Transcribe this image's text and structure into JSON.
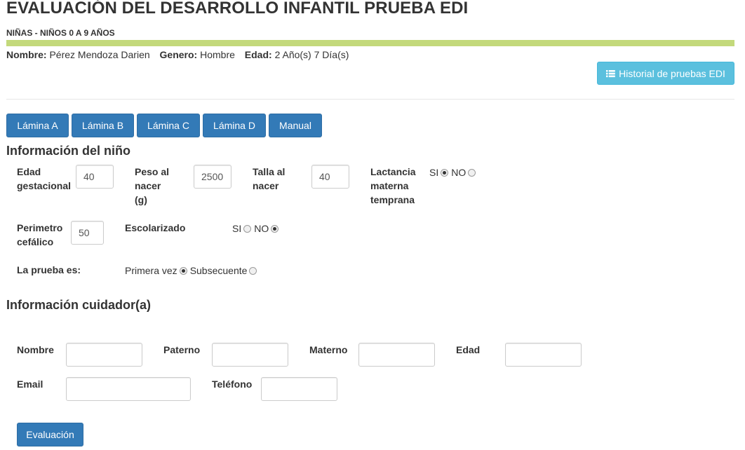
{
  "header": {
    "title": "EVALUACIÓN DEL DESARROLLO INFANTIL PRUEBA EDI",
    "subtitle": "NIÑAS - NIÑOS 0 A 9 AÑOS",
    "accent_bar_color": "#c3d97b"
  },
  "patient": {
    "nombre_label": "Nombre:",
    "nombre_value": "Pérez Mendoza Darien",
    "genero_label": "Genero:",
    "genero_value": "Hombre",
    "edad_label": "Edad:",
    "edad_value": "2 Año(s) 7 Día(s)"
  },
  "history_button": {
    "label": "Historial de pruebas EDI",
    "icon": "list-icon",
    "color": "#5bc0de"
  },
  "tabs": [
    {
      "label": "Lámina A"
    },
    {
      "label": "Lámina B"
    },
    {
      "label": "Lámina C"
    },
    {
      "label": "Lámina D"
    },
    {
      "label": "Manual"
    }
  ],
  "child_info": {
    "heading": "Información del niño",
    "edad_gestacional": {
      "label_1": "Edad",
      "label_2": "gestacional",
      "value": "40"
    },
    "peso_nacer": {
      "label_1": "Peso al",
      "label_2": "nacer",
      "label_3": "(g)",
      "value": "2500"
    },
    "talla_nacer": {
      "label_1": "Talla al",
      "label_2": "nacer",
      "value": "40"
    },
    "lactancia": {
      "label_1": "Lactancia",
      "label_2": "materna",
      "label_3": "temprana",
      "si": "SI",
      "no": "NO",
      "selected": "SI"
    },
    "perimetro": {
      "label_1": "Perimetro",
      "label_2": "cefálico",
      "value": "50"
    },
    "escolarizado": {
      "label": "Escolarizado",
      "si": "SI",
      "no": "NO",
      "selected": "NO"
    },
    "prueba": {
      "label": "La prueba es:",
      "opt1": "Primera vez",
      "opt2": "Subsecuente",
      "selected": "Primera vez"
    }
  },
  "caregiver": {
    "heading": "Información cuidador(a)",
    "nombre_label": "Nombre",
    "nombre_value": "",
    "paterno_label": "Paterno",
    "paterno_value": "",
    "materno_label": "Materno",
    "materno_value": "",
    "edad_label": "Edad",
    "edad_value": "",
    "email_label": "Email",
    "email_value": "",
    "telefono_label": "Teléfono",
    "telefono_value": ""
  },
  "submit_button": {
    "label": "Evaluación",
    "color": "#337ab7"
  }
}
